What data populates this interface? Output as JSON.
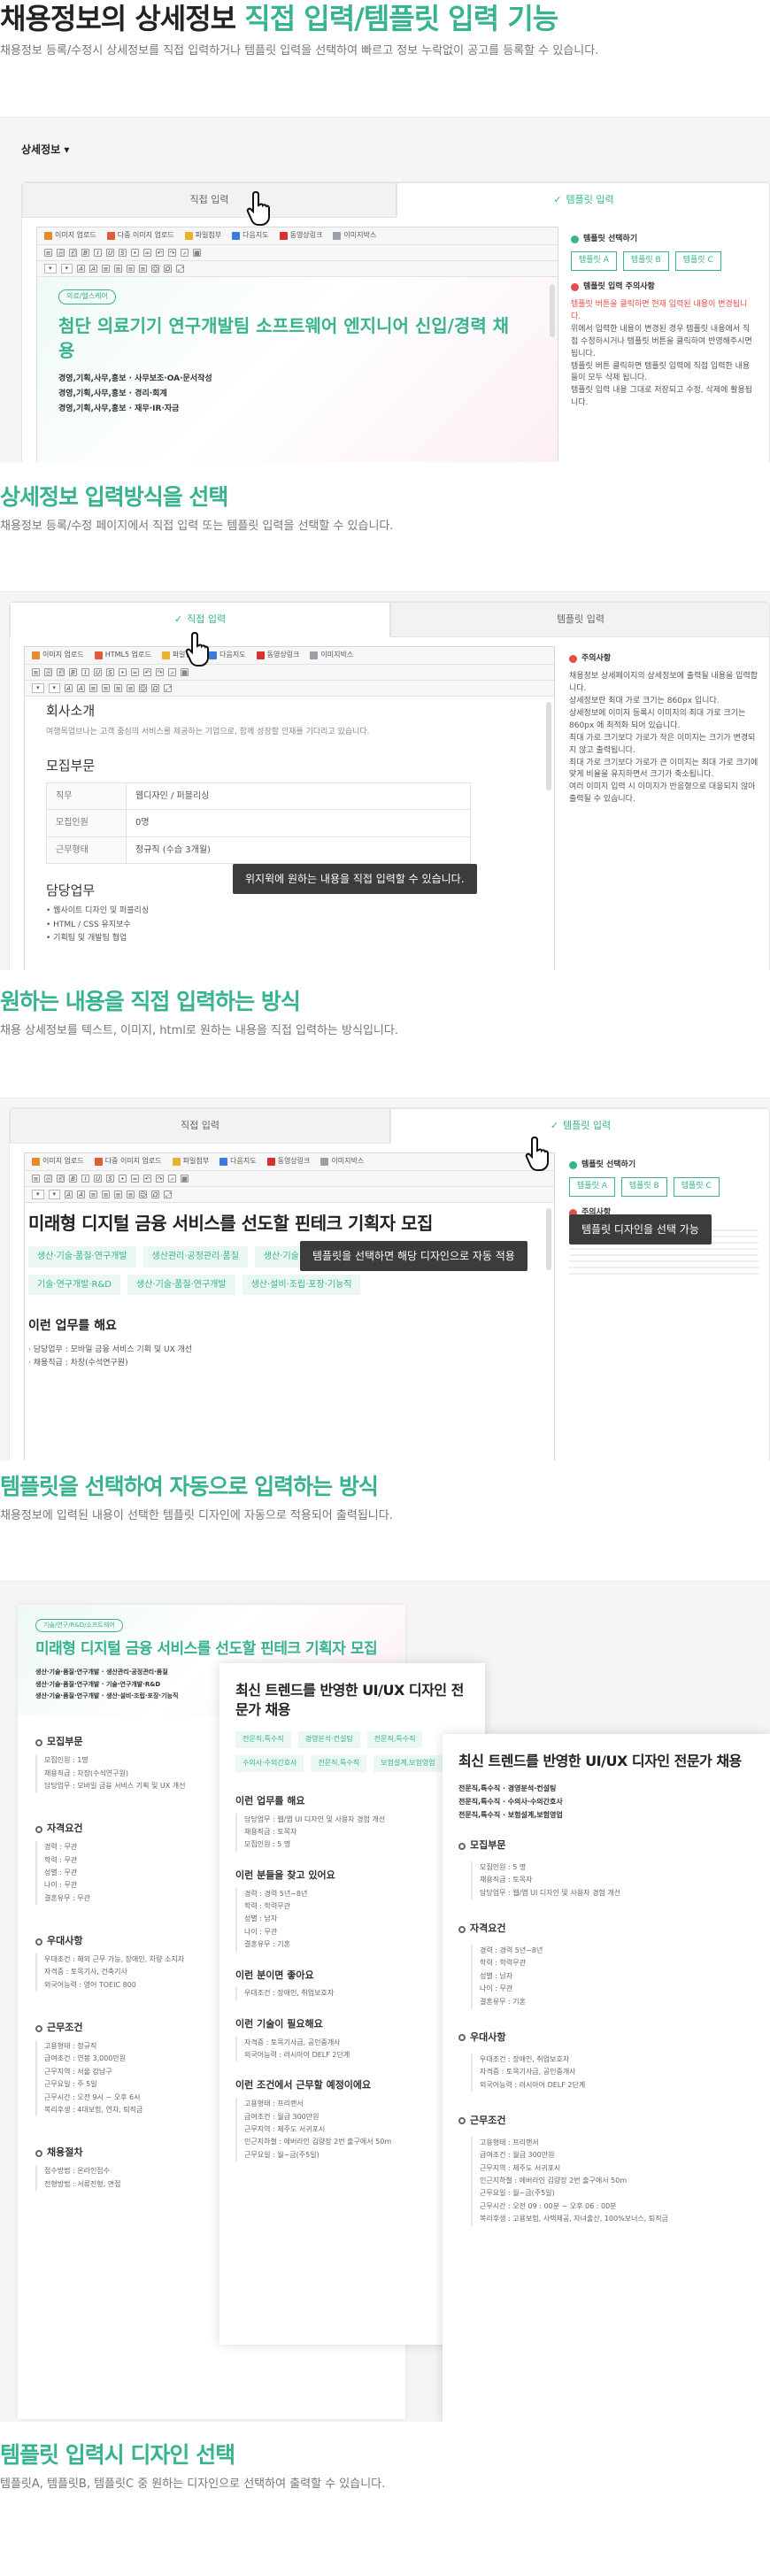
{
  "section1": {
    "title_dark": "채용정보의 상세정보",
    "title_green": "직접 입력/템플릿 입력 기능",
    "subtitle": "채용정보 등록/수정시 상세정보를 직접 입력하거나 템플릿 입력을 선택하여 빠르고 정보 누락없이 공고를 등록할 수 있습니다."
  },
  "panel1": {
    "label": "상세정보",
    "tab_direct": "직접 입력",
    "tab_template": "템플릿 입력",
    "toolbar": [
      "이미지 업로드",
      "다중 이미지 업로드",
      "파일첨부",
      "다음지도",
      "동영상링크",
      "이미지박스"
    ],
    "badge": "의료/헬스케어",
    "headline": "첨단 의료기기 연구개발팀 소프트웨어 엔지니어 신입/경력 채용",
    "lines": [
      "경영,기획,사무,홍보 · 사무보조·OA·문서작성",
      "경영,기획,사무,홍보 · 경리·회계",
      "경영,기획,사무,홍보 · 재무·IR·자금"
    ],
    "side_title": "템플릿 선택하기",
    "template_buttons": [
      "템플릿 A",
      "템플릿 B",
      "템플릿 C"
    ],
    "notice_title": "템플릿 입력 주의사항",
    "notice_red": "템플릿 버튼을 클릭하면 현재 입력된 내용이 변경됩니다.",
    "notice_lines": [
      "위에서 입력한 내용이 변경된 경우 템플릿 내용에서 직접 수정하시거나 템플릿 버튼을 클릭하여 반영해주시면 됩니다.",
      "템플릿 버튼 클릭하면 템플릿 입력에 직접 입력한 내용들이 모두 삭제 됩니다.",
      "템플릿 입력 내용 그대로 저장되고 수정, 삭제에 활용됩니다."
    ]
  },
  "section2": {
    "title": "상세정보 입력방식을 선택",
    "subtitle": "채용정보 등록/수정 페이지에서 직접 입력 또는 템플릿 입력을 선택할 수 있습니다."
  },
  "panel2": {
    "tab_direct": "직접 입력",
    "tab_template": "템플릿 입력",
    "toolbar": [
      "이미지 업로드",
      "HTML5 업로드",
      "파일첨부",
      "다음지도",
      "동영상링크",
      "이미지박스"
    ],
    "company_heading": "회사소개",
    "company_text": "여행목업브나는 고객 중심의 서비스를 제공하는 기업으로, 함께 성장할 인재를 기다리고 있습니다.",
    "recruit_heading": "모집부문",
    "table": [
      [
        "직무",
        "웹디자인 / 퍼블리싱"
      ],
      [
        "모집인원",
        "0명"
      ],
      [
        "근무형태",
        "정규직 (수습 3개월)"
      ]
    ],
    "duty_heading": "담당업무",
    "duties": [
      "웹사이트 디자인 및 퍼블리싱",
      "HTML / CSS 유지보수",
      "기획팀 및 개발팀 협업"
    ],
    "tooltip": "위지윅에 원하는 내용을 직접 입력할 수 있습니다.",
    "side_title": "주의사항",
    "side_lines": [
      "채용정보 상세페이지의 상세정보에 출력될 내용을 입력합니다.",
      "상세정보란 최대 가로 크기는 860px 입니다.",
      "상세정보에 이미지 등록시 이미지의 최대 가로 크기는 860px 에 최적화 되어 있습니다.",
      "최대 가로 크기보다 가로가 작은 이미지는 크기가 변경되지 않고 출력됩니다.",
      "최대 가로 크기보다 가로가 큰 이미지는 최대 가로 크기에 맞게 비율을 유지하면서 크기가 축소됩니다.",
      "여러 이미지 입력 시 이미지가 반응형으로 대응되지 않아 출력될 수 있습니다."
    ]
  },
  "section3": {
    "title": "원하는 내용을 직접 입력하는 방식",
    "subtitle": "채용 상세정보를 텍스트, 이미지, html로 원하는 내용을 직접 입력하는 방식입니다."
  },
  "panel3": {
    "tab_direct": "직접 입력",
    "tab_template": "템플릿 입력",
    "toolbar": [
      "이미지 업로드",
      "다중 이미지 업로드",
      "파일첨부",
      "다음지도",
      "동영상링크",
      "이미지박스"
    ],
    "headline": "미래형 디지털 금융 서비스를 선도할 핀테크 기획자 모집",
    "tags": [
      "생산·기술·품질·연구개발",
      "생산관리·공정관리·품질",
      "생산·기술·품질·연구개발",
      "기술·연구개발·R&D",
      "생산·기술·품질·연구개발",
      "생산·설비·조립·포장·기능직"
    ],
    "duty_heading": "이런 업무를 해요",
    "duty_lines": [
      "· 담당업무 : 모바일 금융 서비스 기획 및 UX 개선",
      "· 채용직급 : 차장(수석연구원)"
    ],
    "side_title": "템플릿 선택하기",
    "template_buttons": [
      "템플릿 A",
      "템플릿 B",
      "템플릿 C"
    ],
    "notice_title": "주의사항",
    "tooltip_editor": "템플릿을 선택하면 해당 디자인으로 자동 적용",
    "tooltip_side": "템플릿 디자인을 선택 가능"
  },
  "section4": {
    "title": "템플릿을 선택하여 자동으로 입력하는 방식",
    "subtitle": "채용정보에 입력된 내용이 선택한 템플릿 디자인에 자동으로 적용되어 출력됩니다."
  },
  "panel4": {
    "docA": {
      "badge": "기술/연구/R&D/소프트웨어",
      "headline": "미래형 디지털 금융 서비스를 선도할 핀테크 기획자 모집",
      "tags": [
        "생산·기술·품질·연구개발",
        "생산관리·공정관리·품질",
        "생산·기술·품질·연구개발",
        "기술·연구개발·R&D",
        "생산·기술·품질·연구개발",
        "생산·설비·조립·포장·기능직"
      ],
      "sections": [
        {
          "title": "모집부문",
          "lines": [
            "모집인원 : 1명",
            "채용직급 : 차장(수석연구원)",
            "담당업무 : 모바일 금융 서비스 기획 및 UX 개선"
          ]
        },
        {
          "title": "자격요건",
          "lines": [
            "경력 : 무관",
            "학력 : 무관",
            "성별 : 무관",
            "나이 : 무관",
            "결혼유무 : 무관"
          ]
        },
        {
          "title": "우대사항",
          "lines": [
            "우대조건 : 해외 근무 가능, 장애인, 차량 소지자",
            "자격증 : 토목기사, 건축기사",
            "외국어능력 : 영어 TOEIC 800"
          ]
        },
        {
          "title": "근무조건",
          "lines": [
            "고용형태 : 정규직",
            "급여조건 : 연봉 3,000만원",
            "근무지역 : 서울 강남구",
            "근무요일 : 주 5일",
            "근무시간 : 오전 9시 ~ 오후 6시",
            "복리후생 : 4대보험, 연차, 퇴직금"
          ]
        },
        {
          "title": "채용절차",
          "lines": [
            "접수방법 : 온라인접수",
            "전형방법 : 서류전형, 면접"
          ]
        }
      ]
    },
    "docB": {
      "headline": "최신 트렌드를 반영한 UI/UX 디자인 전문가 채용",
      "tags": [
        "전문직,특수직",
        "경영분석·컨설팅",
        "전문직,특수직",
        "수의사·수의간호사",
        "전문직,특수직",
        "보험설계,보험영업"
      ],
      "sections": [
        {
          "title": "이런 업무를 해요",
          "lines": [
            "담당업무 : 웹/앱 UI 디자인 및 사용자 경험 개선",
            "채용직급 : 토목자",
            "모집인원 : 5 명"
          ]
        },
        {
          "title": "이런 분들을 찾고 있어요",
          "lines": [
            "경력 : 경력 5년~8년",
            "학력 : 학력무관",
            "성별 : 남자",
            "나이 : 무관",
            "결혼유무 : 기혼"
          ]
        },
        {
          "title": "이런 분이면 좋아요",
          "lines": [
            "우대조건 : 장애인, 취업보호자"
          ]
        },
        {
          "title": "이런 기술이 필요해요",
          "lines": [
            "자격증 : 토목기사급, 공인중개사",
            "외국어능력 : 러시아어 DELF 2단계"
          ]
        },
        {
          "title": "이런 조건에서 근무할 예정이에요",
          "lines": [
            "고용형태 : 프리랜서",
            "급여조건 : 월급 300만원",
            "근무지역 : 제주도 서귀포시",
            "인근지하철 : 에버라인 김량장 2번 출구에서 50m",
            "근무요일 : 월~금(주5일)"
          ]
        }
      ]
    },
    "docC": {
      "headline": "최신 트렌드를 반영한 UI/UX 디자인 전문가 채용",
      "lines": [
        "전문직,특수직 · 경영분석·컨설팅",
        "전문직,특수직 · 수의사·수의간호사",
        "전문직,특수직 · 보험설계,보험영업"
      ],
      "sections": [
        {
          "title": "모집부문",
          "lines": [
            "모집인원 : 5 명",
            "채용직급 : 토목자",
            "담당업무 : 웹/앱 UI 디자인 및 사용자 경험 개선"
          ]
        },
        {
          "title": "자격요건",
          "lines": [
            "경력 : 경력 5년~8년",
            "학력 : 학력무관",
            "성별 : 남자",
            "나이 : 무관",
            "결혼유무 : 기혼"
          ]
        },
        {
          "title": "우대사항",
          "lines": [
            "우대조건 : 장애인, 취업보호자",
            "자격증 : 토목기사급, 공인중개사",
            "외국어능력 : 러시아어 DELF 2단계"
          ]
        },
        {
          "title": "근무조건",
          "lines": [
            "고용형태 : 프리랜서",
            "급여조건 : 월급 300만원",
            "근무지역 : 제주도 서귀포시",
            "인근지하철 : 에버라인 김량장 2번 출구에서 50m",
            "근무요일 : 월~금(주5일)",
            "근무시간 : 오전 09 : 00분 ~ 오후 06 : 00분",
            "복리후생 : 고용보험, 사택제공, 자녀출산, 100%보너스, 퇴직금"
          ]
        }
      ]
    }
  },
  "section5": {
    "title": "템플릿 입력시 디자인 선택",
    "subtitle": "템플릿A, 템플릿B, 템플릿C 중 원하는 디자인으로 선택하여 출력할 수 있습니다."
  }
}
